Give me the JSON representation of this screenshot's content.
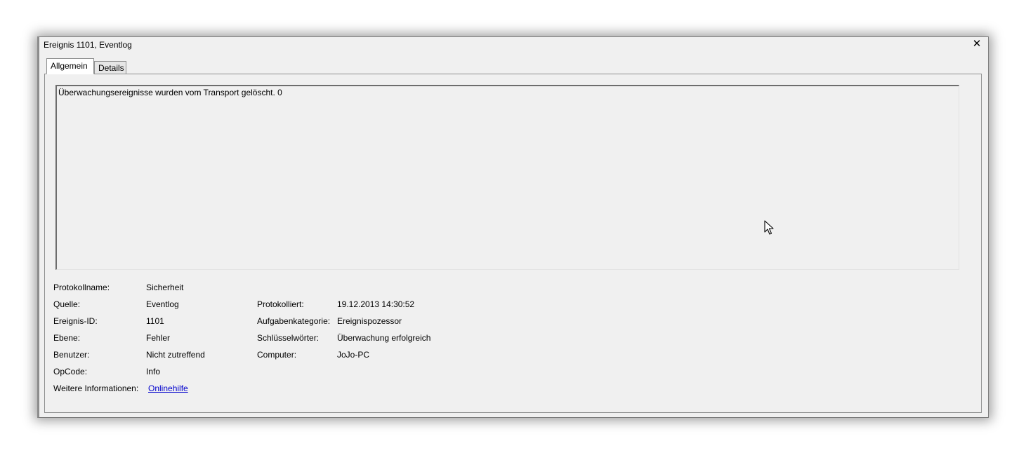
{
  "window": {
    "title": "Ereignis 1101, Eventlog",
    "close_glyph": "✕"
  },
  "tabs": [
    {
      "label": "Allgemein",
      "active": true
    },
    {
      "label": "Details",
      "active": false
    }
  ],
  "message": "Überwachungsereignisse wurden vom Transport gelöscht. 0",
  "fields_left": [
    {
      "label": "Protokollname:",
      "value": "Sicherheit"
    },
    {
      "label": "Quelle:",
      "value": "Eventlog"
    },
    {
      "label": "Ereignis-ID:",
      "value": "1101"
    },
    {
      "label": "Ebene:",
      "value": "Fehler"
    },
    {
      "label": "Benutzer:",
      "value": "Nicht zutreffend"
    },
    {
      "label": "OpCode:",
      "value": "Info"
    },
    {
      "label": "Weitere Informationen:",
      "value": "Onlinehilfe"
    }
  ],
  "fields_right": [
    {
      "label": "Protokolliert:",
      "value": "19.12.2013 14:30:52"
    },
    {
      "label": "Aufgabenkategorie:",
      "value": "Ereignispozessor"
    },
    {
      "label": "Schlüsselwörter:",
      "value": "Überwachung erfolgreich"
    },
    {
      "label": "Computer:",
      "value": "JoJo-PC"
    }
  ],
  "colors": {
    "window_bg": "#f0f0f0",
    "link": "#0000cc"
  }
}
